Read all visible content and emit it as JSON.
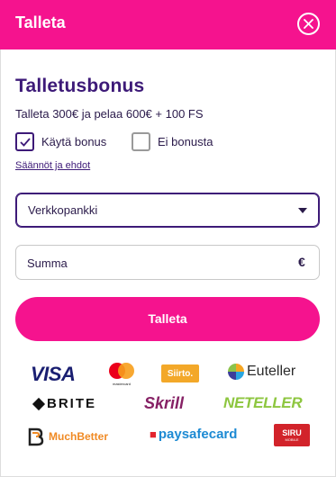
{
  "header": {
    "title": "Talleta",
    "close_icon": "close-icon"
  },
  "bonus": {
    "title": "Talletusbonus",
    "description": "Talleta 300€ ja pelaa 600€ + 100 FS",
    "use_bonus_label": "Käytä bonus",
    "use_bonus_checked": true,
    "no_bonus_label": "Ei bonusta",
    "no_bonus_checked": false,
    "terms_link": "Säännöt ja ehdot"
  },
  "payment_method": {
    "selected": "Verkkopankki",
    "icon": "caret-down-icon"
  },
  "amount": {
    "placeholder": "Summa",
    "value": "",
    "currency": "€"
  },
  "deposit_button": "Talleta",
  "providers": {
    "visa": "VISA",
    "mastercard_caption": "mastercard",
    "siirto": "Siirto.",
    "euteller": "Euteller",
    "brite": "BRITE",
    "skrill": "Skrill",
    "neteller": "NETELLER",
    "muchbetter": "MuchBetter",
    "paysafecard": "paysafecard",
    "siru": "SIRU",
    "siru_caption": "MOBILE"
  },
  "colors": {
    "brand_pink": "#f5138e",
    "brand_purple": "#3d1a78"
  }
}
